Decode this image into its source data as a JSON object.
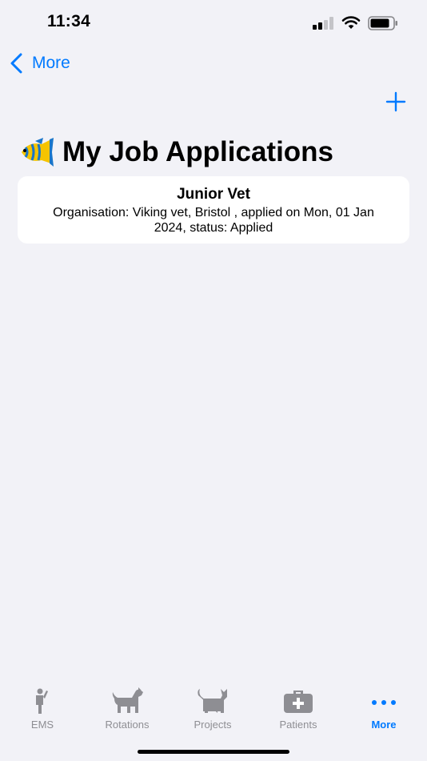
{
  "status_bar": {
    "time": "11:34",
    "battery_icon": "battery-icon",
    "wifi_icon": "wifi-icon",
    "signal_icon": "signal-icon"
  },
  "nav": {
    "back_label": "More",
    "back_icon": "chevron-left-icon",
    "add_icon": "plus-icon"
  },
  "page": {
    "title": "My Job Applications",
    "title_icon": "tropical-fish-icon"
  },
  "applications": [
    {
      "title": "Junior Vet",
      "detail": "Organisation: Viking vet, Bristol , applied on Mon, 01 Jan 2024, status: Applied"
    }
  ],
  "tab_bar": {
    "tabs": [
      {
        "label": "EMS",
        "icon": "person-waving-icon"
      },
      {
        "label": "Rotations",
        "icon": "dog-icon"
      },
      {
        "label": "Projects",
        "icon": "cat-icon"
      },
      {
        "label": "Patients",
        "icon": "medical-bag-icon"
      },
      {
        "label": "More",
        "icon": "ellipsis-icon",
        "active": true
      }
    ]
  },
  "colors": {
    "accent": "#007aff",
    "background": "#f2f2f7",
    "card": "#ffffff",
    "tab_inactive": "#8e8e93"
  }
}
